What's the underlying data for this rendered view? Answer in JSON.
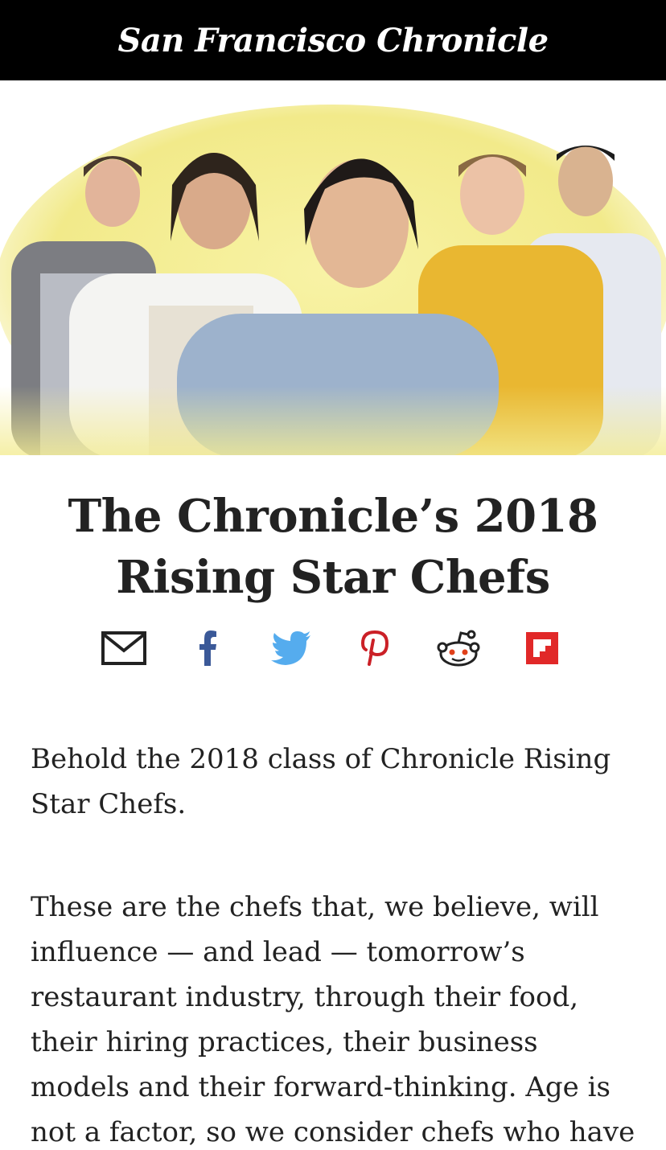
{
  "masthead": {
    "logo_text": "San Francisco Chronicle"
  },
  "hero": {
    "alt": "Portrait of five chefs against a yellow painted background"
  },
  "article": {
    "title": "The Chronicle’s 2018 Rising Star Chefs",
    "paragraphs": [
      "Behold the 2018 class of Chronicle Rising Star Chefs.",
      "These are the chefs that, we believe, will influence — and lead — tomorrow’s restaurant industry, through their food, their hiring practices, their business models and their forward-thinking. Age is not a factor, so we consider chefs who have fewer than five years’"
    ]
  },
  "share": {
    "icons": [
      "envelope-icon",
      "facebook-icon",
      "twitter-icon",
      "pinterest-icon",
      "reddit-icon",
      "flipboard-icon"
    ],
    "colors": {
      "email": "#222222",
      "facebook": "#3b5998",
      "twitter": "#55acee",
      "pinterest": "#cb2027",
      "reddit": "#222222",
      "flipboard": "#e12828"
    }
  }
}
